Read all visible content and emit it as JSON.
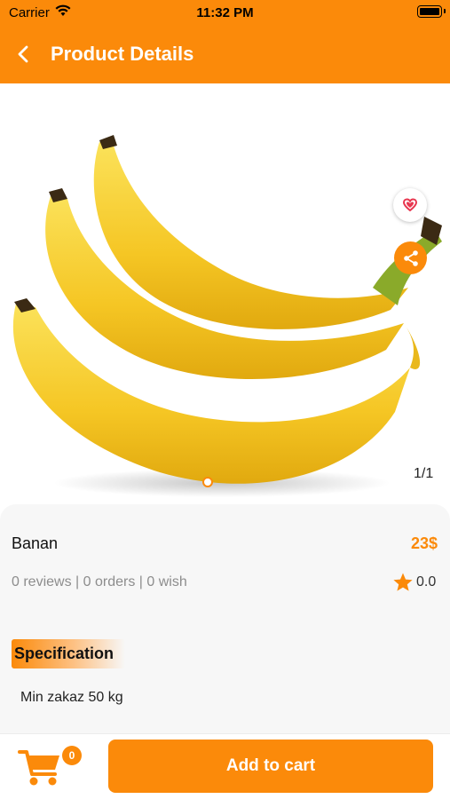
{
  "status_bar": {
    "carrier": "Carrier",
    "time": "11:32 PM"
  },
  "header": {
    "title": "Product Details",
    "back_icon": "chevron-left-icon"
  },
  "gallery": {
    "page_indicator": "1/1",
    "favorite_icon": "heart-icon",
    "share_icon": "share-icon"
  },
  "product": {
    "name": "Banan",
    "price": "23$",
    "stats": "0 reviews | 0 orders | 0 wish",
    "rating": "0.0"
  },
  "specification": {
    "heading": "Specification",
    "text": "Min zakaz 50 kg"
  },
  "cart": {
    "count": "0",
    "add_label": "Add to cart"
  },
  "colors": {
    "accent": "#fb8a0a",
    "heart": "#e8364f",
    "background": "#f7f7f7"
  }
}
